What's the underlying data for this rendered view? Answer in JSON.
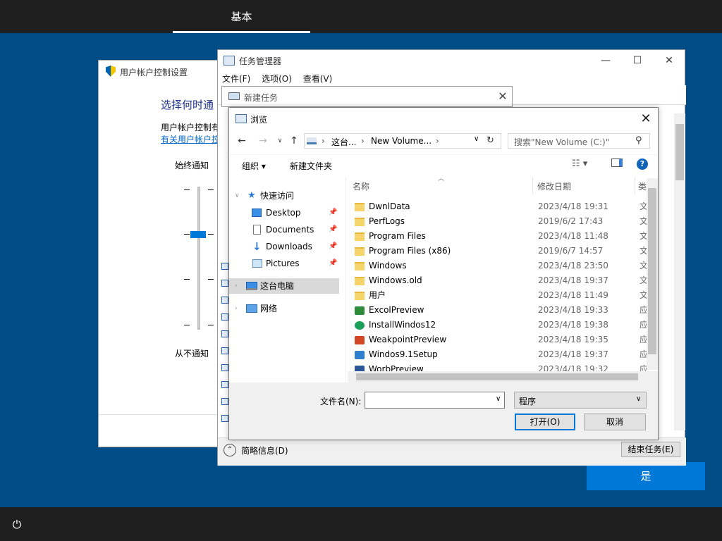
{
  "oobe": {
    "tab_label": "基本",
    "yes_button": "是",
    "power_icon": "⏻"
  },
  "uac": {
    "title": "用户帐户控制设置",
    "heading": "选择何时通",
    "description": "用户帐户控制有",
    "link": "有关用户帐户控",
    "always_notify": "始终通知",
    "never_notify": "从不通知"
  },
  "task_manager": {
    "title": "任务管理器",
    "menu": [
      "文件(F)",
      "选项(O)",
      "查看(V)"
    ],
    "brief_label": "简略信息(D)",
    "end_task_button": "结束任务(E)",
    "window_controls": {
      "minimize": "—",
      "maximize": "☐",
      "close": "✕"
    }
  },
  "new_task": {
    "title": "新建任务",
    "close": "✕"
  },
  "browse": {
    "title": "浏览",
    "close": "✕",
    "nav": {
      "back": "←",
      "forward": "→",
      "recent": "∨",
      "up": "↑"
    },
    "breadcrumb": [
      "这台...",
      "New Volume..."
    ],
    "search_placeholder": "搜索\"New Volume (C:)\"",
    "organize": "组织 ▾",
    "new_folder": "新建文件夹",
    "help": "?",
    "tree": [
      {
        "label": "快速访问",
        "icon": "star-icon"
      },
      {
        "label": "Desktop",
        "icon": "desktop-icon"
      },
      {
        "label": "Documents",
        "icon": "documents-icon"
      },
      {
        "label": "Downloads",
        "icon": "downloads-icon"
      },
      {
        "label": "Pictures",
        "icon": "pictures-icon"
      },
      {
        "label": "这台电脑",
        "icon": "this-pc-icon"
      },
      {
        "label": "网络",
        "icon": "network-icon"
      }
    ],
    "columns": {
      "name": "名称",
      "date": "修改日期",
      "type": "类"
    },
    "files": [
      {
        "name": "DwnlData",
        "date": "2023/4/18 19:31",
        "type": "文",
        "kind": "folder"
      },
      {
        "name": "PerfLogs",
        "date": "2019/6/2 17:43",
        "type": "文",
        "kind": "folder"
      },
      {
        "name": "Program Files",
        "date": "2023/4/18 11:48",
        "type": "文",
        "kind": "folder"
      },
      {
        "name": "Program Files (x86)",
        "date": "2019/6/7 14:57",
        "type": "文",
        "kind": "folder"
      },
      {
        "name": "Windows",
        "date": "2023/4/18 23:50",
        "type": "文",
        "kind": "folder"
      },
      {
        "name": "Windows.old",
        "date": "2023/4/18 19:37",
        "type": "文",
        "kind": "folder"
      },
      {
        "name": "用户",
        "date": "2023/4/18 11:49",
        "type": "文",
        "kind": "folder"
      },
      {
        "name": "ExcolPreview",
        "date": "2023/4/18 19:33",
        "type": "应",
        "kind": "app",
        "color": "#2e8b3a"
      },
      {
        "name": "InstallWindos12",
        "date": "2023/4/18 19:38",
        "type": "应",
        "kind": "app",
        "color": "#1a9e5a"
      },
      {
        "name": "WeakpointPreview",
        "date": "2023/4/18 19:35",
        "type": "应",
        "kind": "app",
        "color": "#d24726"
      },
      {
        "name": "Windos9.1Setup",
        "date": "2023/4/18 19:37",
        "type": "应",
        "kind": "app",
        "color": "#2f7fd0"
      },
      {
        "name": "WorbPreview",
        "date": "2023/4/18 19:32",
        "type": "应",
        "kind": "app",
        "color": "#2b579a"
      }
    ],
    "filename_label": "文件名(N):",
    "filename_value": "",
    "filetype": "程序",
    "open_button": "打开(O)",
    "cancel_button": "取消"
  }
}
